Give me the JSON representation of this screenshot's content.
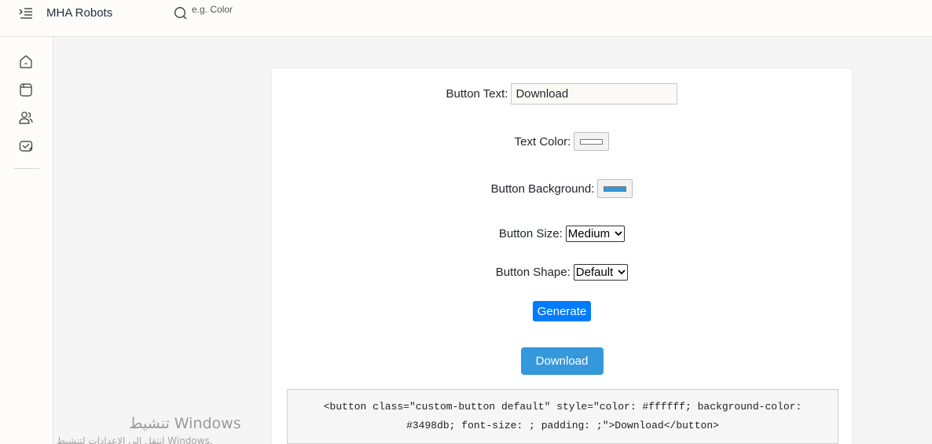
{
  "header": {
    "brand": "MHA Robots",
    "search_placeholder": "e.g. Color"
  },
  "sidebar": {
    "items": [
      {
        "icon": "home-icon"
      },
      {
        "icon": "document-icon"
      },
      {
        "icon": "users-icon"
      },
      {
        "icon": "mail-check-icon"
      }
    ]
  },
  "form": {
    "button_text_label": "Button Text:",
    "button_text_value": "Download",
    "text_color_label": "Text Color:",
    "text_color_value": "#ffffff",
    "button_background_label": "Button Background:",
    "button_background_value": "#3498db",
    "button_size_label": "Button Size:",
    "button_size_value": "Medium",
    "button_shape_label": "Button Shape:",
    "button_shape_value": "Default",
    "generate_label": "Generate"
  },
  "preview": {
    "button_label": "Download"
  },
  "code": {
    "line1": "<button class=\"custom-button default\" style=\"color: #ffffff; background-color:",
    "line2": "#3498db; font-size: ; padding: ;\">Download</button>"
  },
  "watermark": {
    "title": "تنشيط Windows",
    "subtitle": "انتقل إلى الإعدادات لتنشيط Windows."
  },
  "colors": {
    "accent": "#007bff",
    "preview_bg": "#3498db",
    "topbar_bg": "#fdfcf9",
    "page_bg": "#f5f5f5"
  }
}
